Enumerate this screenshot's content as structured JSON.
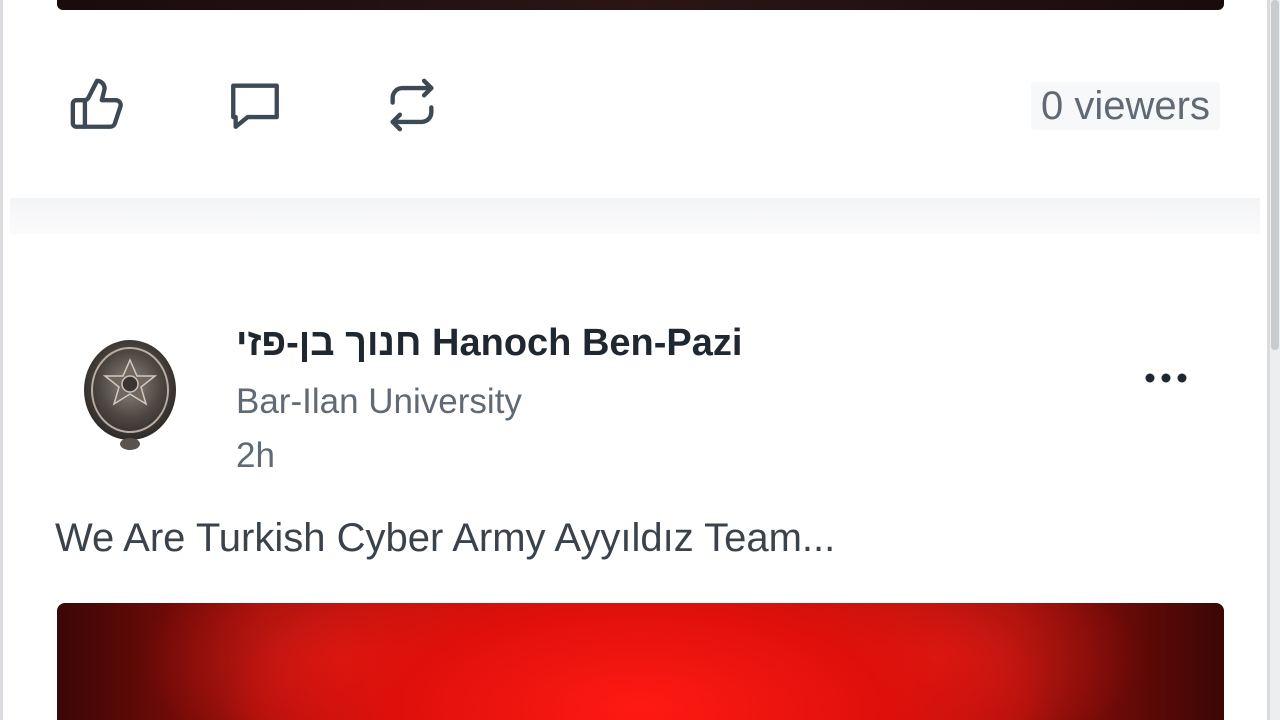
{
  "feed": {
    "previous_post": {
      "viewers_text": "0 viewers",
      "actions": {
        "like_icon": "thumbs-up-icon",
        "comment_icon": "comment-icon",
        "repost_icon": "repost-icon"
      }
    },
    "post": {
      "author_name": "חנוך בן-פזי Hanoch Ben-Pazi",
      "affiliation": "Bar-Ilan University",
      "timestamp": "2h",
      "text": "We Are Turkish Cyber Army Ayyıldız Team...",
      "more_icon": "more-horizontal-icon",
      "avatar_icon": "emblem-avatar-icon",
      "image_color": "#d4110c"
    }
  },
  "colors": {
    "icon": "#3d4a56",
    "secondary_text": "#5f6a75",
    "primary_text": "#1f2730",
    "separator": "#f3f4f6"
  }
}
